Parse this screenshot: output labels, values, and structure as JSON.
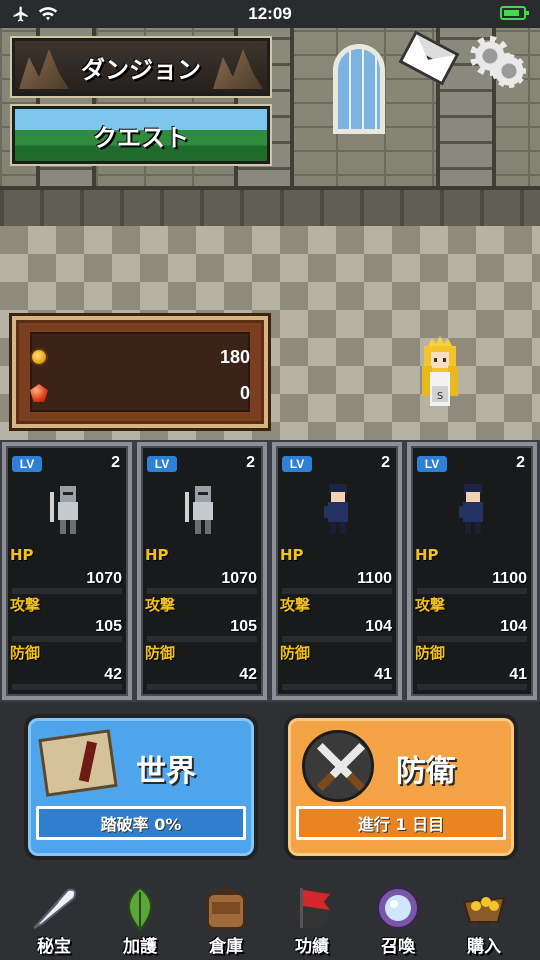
{
  "status_bar": {
    "time": "12:09"
  },
  "scene": {
    "dungeon_label": "ダンジョン",
    "quest_label": "クエスト"
  },
  "currency": {
    "coins": "180",
    "gems": "0"
  },
  "heroes": [
    {
      "lv_badge": "LV",
      "level": "2",
      "hp_label": "HP",
      "hp": "1070",
      "atk_label": "攻撃",
      "atk": "105",
      "def_label": "防御",
      "def": "42",
      "sprite": "armored-knight"
    },
    {
      "lv_badge": "LV",
      "level": "2",
      "hp_label": "HP",
      "hp": "1070",
      "atk_label": "攻撃",
      "atk": "105",
      "def_label": "防御",
      "def": "42",
      "sprite": "armored-knight"
    },
    {
      "lv_badge": "LV",
      "level": "2",
      "hp_label": "HP",
      "hp": "1100",
      "atk_label": "攻撃",
      "atk": "104",
      "def_label": "防御",
      "def": "41",
      "sprite": "dark-haired-swordsman"
    },
    {
      "lv_badge": "LV",
      "level": "2",
      "hp_label": "HP",
      "hp": "1100",
      "atk_label": "攻撃",
      "atk": "104",
      "def_label": "防御",
      "def": "41",
      "sprite": "dark-haired-swordsman"
    }
  ],
  "world": {
    "title": "世界",
    "progress_text": "踏破率 0%",
    "icon": "map-scroll-icon",
    "color": "#4ea5ec"
  },
  "defense": {
    "title": "防衛",
    "progress_text": "進行 1 日目",
    "icon": "crossed-swords-icon",
    "color": "#f3a345"
  },
  "tabs": [
    {
      "label": "秘宝",
      "icon": "feather-icon"
    },
    {
      "label": "加護",
      "icon": "leaf-icon"
    },
    {
      "label": "倉庫",
      "icon": "backpack-icon"
    },
    {
      "label": "功績",
      "icon": "flag-icon"
    },
    {
      "label": "召喚",
      "icon": "crystal-orb-icon"
    },
    {
      "label": "購入",
      "icon": "gold-cart-icon"
    }
  ]
}
